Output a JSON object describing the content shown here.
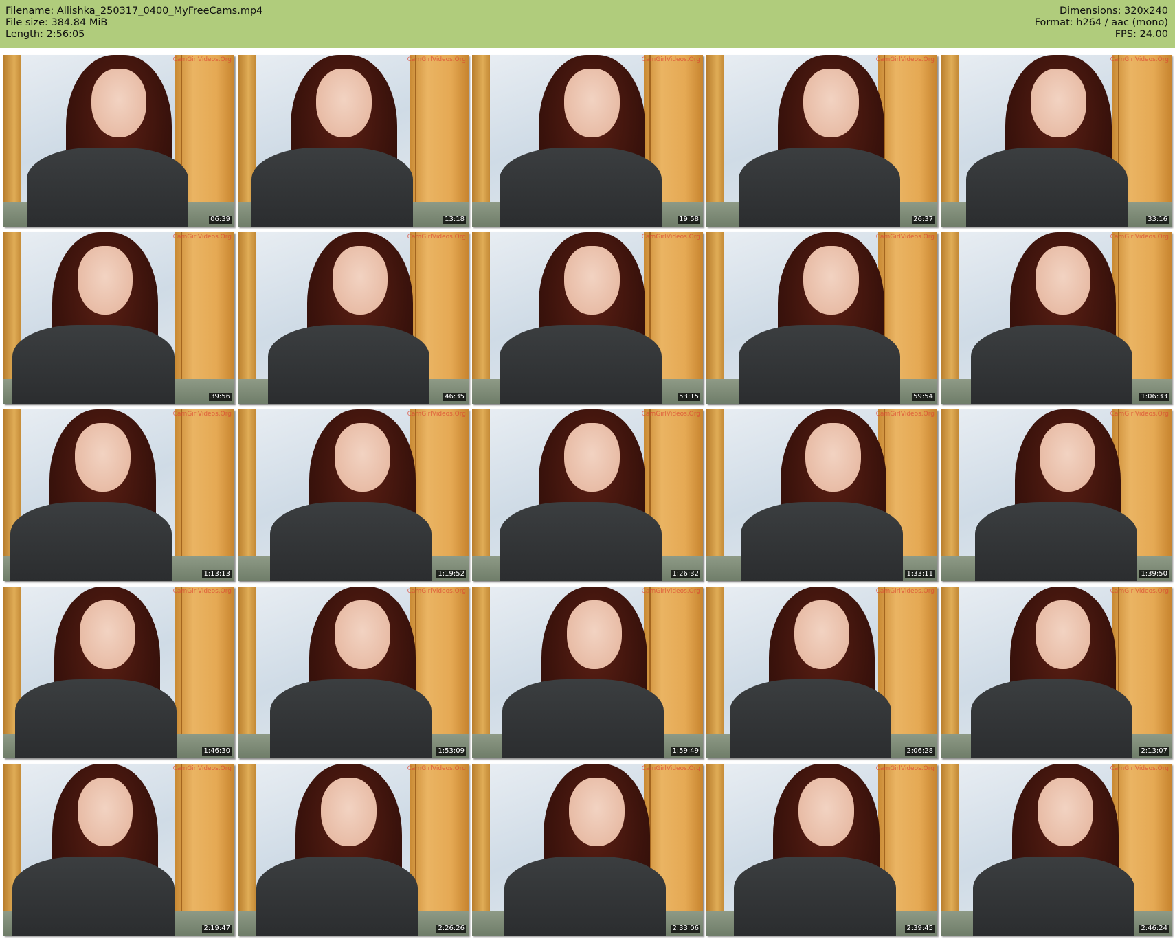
{
  "header": {
    "filename": "Filename: Allishka_250317_0400_MyFreeCams.mp4",
    "filesize": "File size: 384.84 MiB",
    "length": "Length: 2:56:05",
    "dimensions": "Dimensions: 320x240",
    "format": "Format: h264 / aac (mono)",
    "fps": "FPS: 24.00"
  },
  "watermark": "CamGirlVideos.Org",
  "thumbnails": [
    "06:39",
    "13:18",
    "19:58",
    "26:37",
    "33:16",
    "39:56",
    "46:35",
    "53:15",
    "59:54",
    "1:06:33",
    "1:13:13",
    "1:19:52",
    "1:26:32",
    "1:33:11",
    "1:39:50",
    "1:46:30",
    "1:53:09",
    "1:59:49",
    "2:06:28",
    "2:13:07",
    "2:19:47",
    "2:26:26",
    "2:33:06",
    "2:39:45",
    "2:46:24"
  ]
}
